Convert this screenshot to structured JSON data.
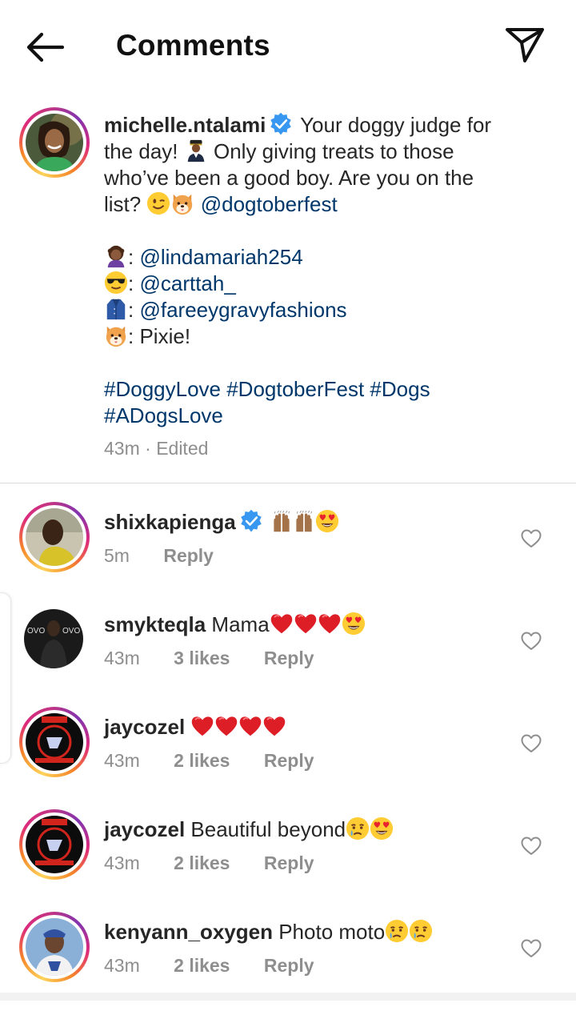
{
  "header": {
    "title": "Comments",
    "back_icon": "arrow-left-icon",
    "send_icon": "paper-plane-icon"
  },
  "post": {
    "username": "michelle.ntalami",
    "verified": true,
    "caption_line1": "Your doggy judge for",
    "caption_line2_a": "the day!",
    "caption_line2_b": "Only giving treats to those",
    "caption_line3": "who’ve been a good boy. Are you on the",
    "caption_line4_a": "list?",
    "caption_mention": "@dogtoberfest",
    "credits": [
      {
        "emoji": "woman-curly-hair-emoji",
        "sep": ":",
        "value": "@lindamariah254"
      },
      {
        "emoji": "sunglasses-face-emoji",
        "sep": ":",
        "value": "@carttah_"
      },
      {
        "emoji": "coat-emoji",
        "sep": ":",
        "value": "@fareeygravyfashions"
      },
      {
        "emoji": "dog-face-emoji",
        "sep": ":",
        "value": "Pixie!"
      }
    ],
    "hashtags_line1": "#DoggyLove #DogtoberFest #Dogs",
    "hashtags_line2": "#ADogsLove",
    "time": "43m",
    "edited": "· Edited"
  },
  "comments": [
    {
      "username": "shixkapienga",
      "verified": true,
      "text": "",
      "emojis": "raising-hands x2, heart-eyes",
      "time": "5m",
      "likes": "",
      "reply": "Reply"
    },
    {
      "username": "smykteqla",
      "verified": false,
      "text": "Mama",
      "emojis": "red-heart x3, heart-eyes",
      "time": "43m",
      "likes": "3 likes",
      "reply": "Reply"
    },
    {
      "username": "jaycozel",
      "verified": false,
      "text": "",
      "emojis": "red-heart x4",
      "time": "43m",
      "likes": "2 likes",
      "reply": "Reply"
    },
    {
      "username": "jaycozel",
      "verified": false,
      "text": "Beautiful beyond",
      "emojis": "crying-face, heart-eyes",
      "time": "43m",
      "likes": "2 likes",
      "reply": "Reply"
    },
    {
      "username": "kenyann_oxygen",
      "verified": false,
      "text": "Photo moto",
      "emojis": "crying-face x2",
      "time": "43m",
      "likes": "2 likes",
      "reply": "Reply"
    }
  ],
  "colors": {
    "link": "#00376b",
    "meta_gray": "#8e8e8e",
    "verified_blue": "#3897f0",
    "heart_red": "#e0161c"
  }
}
